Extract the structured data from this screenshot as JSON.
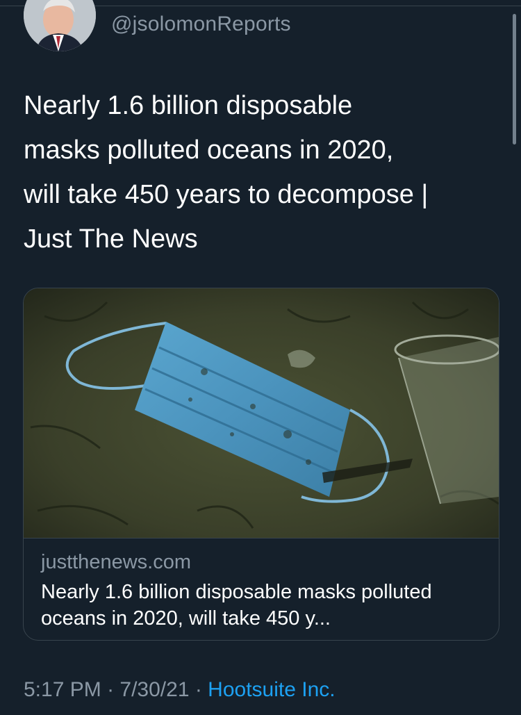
{
  "author": {
    "handle": "@jsolomonReports"
  },
  "tweet": {
    "lines": [
      "Nearly 1.6 billion disposable",
      "masks polluted oceans in 2020,",
      "will take 450 years to decompose |",
      "Just The News"
    ]
  },
  "link_card": {
    "domain": "justthenews.com",
    "title": "Nearly 1.6 billion disposable masks polluted oceans in 2020, will take 450 y..."
  },
  "meta": {
    "time": "5:17 PM",
    "separator": " · ",
    "date": "7/30/21",
    "source": "Hootsuite Inc."
  },
  "colors": {
    "background": "#15202b",
    "secondary_text": "#8b98a5",
    "link": "#1da1f2",
    "border": "#38444d"
  }
}
